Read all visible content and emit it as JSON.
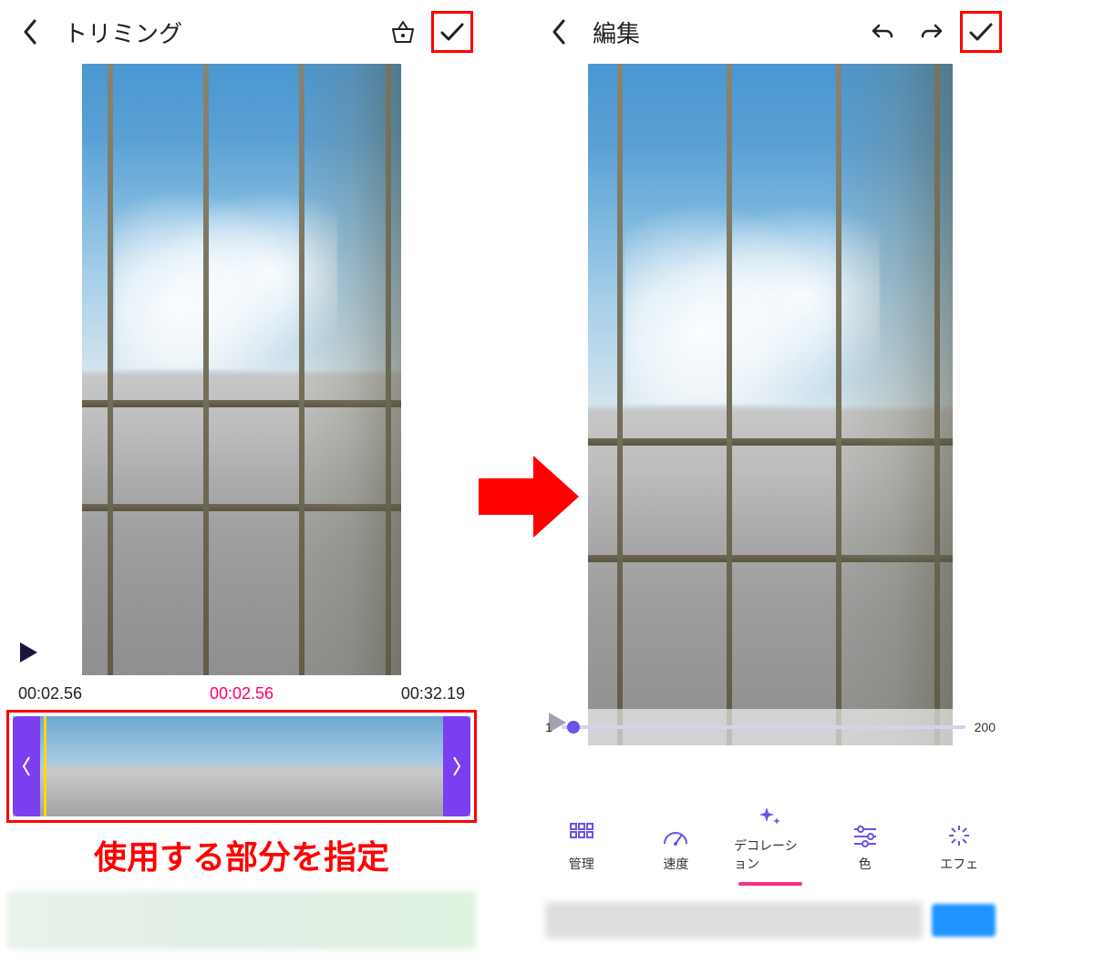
{
  "left": {
    "title": "トリミング",
    "time_start": "00:02.56",
    "time_current": "00:02.56",
    "time_end": "00:32.19",
    "callout": "使用する部分を指定"
  },
  "right": {
    "title": "編集",
    "slider_min": "1",
    "slider_max": "200",
    "tools": [
      {
        "label": "管理"
      },
      {
        "label": "速度"
      },
      {
        "label": "デコレーション"
      },
      {
        "label": "色"
      },
      {
        "label": "エフェ"
      }
    ]
  }
}
